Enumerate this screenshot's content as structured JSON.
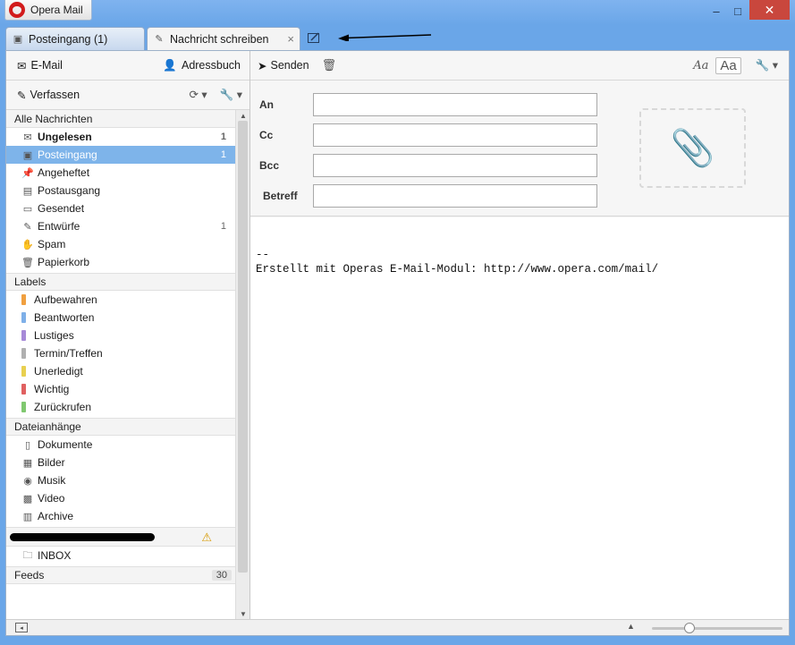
{
  "window": {
    "app_title": "Opera Mail",
    "minimize": "–",
    "maximize": "□",
    "close": "✕"
  },
  "tabs": [
    {
      "label": "Posteingang (1)",
      "icon": "inbox-icon"
    },
    {
      "label": "Nachricht schreiben",
      "icon": "pencil-icon",
      "close": "×"
    }
  ],
  "left_panel": {
    "email_label": "E-Mail",
    "addressbook_label": "Adressbuch",
    "compose_label": "Verfassen",
    "sections": {
      "all_messages": "Alle Nachrichten",
      "labels": "Labels",
      "attachments": "Dateianhänge",
      "feeds": "Feeds",
      "feeds_count": "30"
    },
    "mail_items": [
      {
        "label": "Ungelesen",
        "count": "1",
        "icon": "unread-icon"
      },
      {
        "label": "Posteingang",
        "count": "1",
        "icon": "inbox-icon"
      },
      {
        "label": "Angeheftet",
        "count": "",
        "icon": "pin-icon"
      },
      {
        "label": "Postausgang",
        "count": "",
        "icon": "outbox-icon"
      },
      {
        "label": "Gesendet",
        "count": "",
        "icon": "sent-icon"
      },
      {
        "label": "Entwürfe",
        "count": "1",
        "icon": "drafts-icon"
      },
      {
        "label": "Spam",
        "count": "",
        "icon": "spam-icon"
      },
      {
        "label": "Papierkorb",
        "count": "",
        "icon": "trash-icon"
      }
    ],
    "labels": [
      {
        "label": "Aufbewahren",
        "color": "#f0a040"
      },
      {
        "label": "Beantworten",
        "color": "#7fb0e8"
      },
      {
        "label": "Lustiges",
        "color": "#a78ad8"
      },
      {
        "label": "Termin/Treffen",
        "color": "#b0b0b0"
      },
      {
        "label": "Unerledigt",
        "color": "#e8d050"
      },
      {
        "label": "Wichtig",
        "color": "#e06060"
      },
      {
        "label": "Zurückrufen",
        "color": "#80c870"
      }
    ],
    "attachments": [
      {
        "label": "Dokumente",
        "icon": "document-icon"
      },
      {
        "label": "Bilder",
        "icon": "image-icon"
      },
      {
        "label": "Musik",
        "icon": "music-icon"
      },
      {
        "label": "Video",
        "icon": "video-icon"
      },
      {
        "label": "Archive",
        "icon": "archive-icon"
      }
    ],
    "account_folder": "INBOX"
  },
  "compose": {
    "send_label": "Senden",
    "format_italic": "Aa",
    "format_plain": "Aa",
    "fields": [
      {
        "label": "An",
        "value": ""
      },
      {
        "label": "Cc",
        "value": ""
      },
      {
        "label": "Bcc",
        "value": ""
      },
      {
        "label": "Betreff",
        "value": ""
      }
    ],
    "body": "--\nErstellt mit Operas E-Mail-Modul: http://www.opera.com/mail/"
  }
}
